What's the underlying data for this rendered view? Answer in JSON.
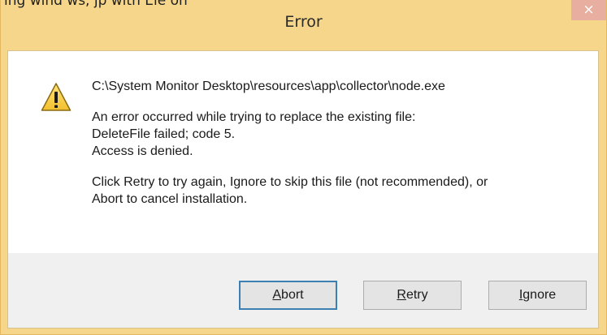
{
  "background_text": "ing wind ws, jp with Ele on",
  "window": {
    "title": "Error",
    "close_glyph": "×"
  },
  "message": {
    "path": "C:\\System Monitor Desktop\\resources\\app\\collector\\node.exe",
    "error_line1": "An error occurred while trying to replace the existing file:",
    "error_line2": "DeleteFile failed; code 5.",
    "error_line3": "Access is denied.",
    "instruction_line1": "Click Retry to try again, Ignore to skip this file (not recommended), or",
    "instruction_line2": "Abort to cancel installation."
  },
  "icons": {
    "warning": "warning-triangle-icon",
    "close": "close-icon"
  },
  "buttons": {
    "abort": {
      "mnemonic": "A",
      "rest": "bort"
    },
    "retry": {
      "mnemonic": "R",
      "rest": "etry"
    },
    "ignore": {
      "mnemonic": "I",
      "rest": "gnore"
    }
  },
  "colors": {
    "frame": "#f5d68b",
    "close_button": "#e8afa0",
    "default_button_border": "#3c7fb1"
  }
}
